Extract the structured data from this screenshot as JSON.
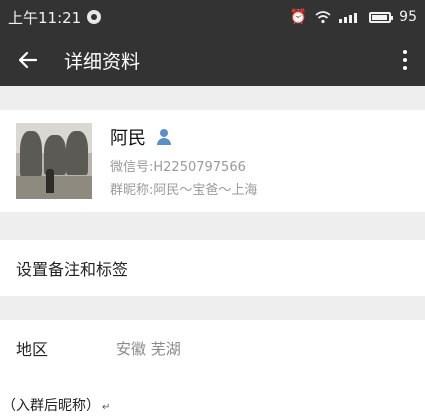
{
  "status_bar": {
    "time": "上午11:21",
    "battery": "95",
    "battery_level": 0.95,
    "icons": [
      "notification-icon",
      "alarm-icon",
      "wifi-icon",
      "signal-icon",
      "battery-icon"
    ]
  },
  "title_bar": {
    "title": "详细资料",
    "back_icon": "back-arrow-icon",
    "more_icon": "more-vertical-icon"
  },
  "profile": {
    "name": "阿民",
    "gender_icon": "male-user-icon",
    "wechat_id": "微信号:H2250797566",
    "group_nickname": "群昵称:阿民～宝爸～上海"
  },
  "remarks": {
    "label": "设置备注和标签"
  },
  "region": {
    "label": "地区",
    "value": "安徽  芜湖"
  },
  "caption": {
    "text": "（入群后昵称）",
    "mark": "↵"
  },
  "colors": {
    "header": "#333333",
    "background_gap": "#eeeeee",
    "secondary_text": "#9a9a9a",
    "gender_icon": "#5a8fc7"
  }
}
